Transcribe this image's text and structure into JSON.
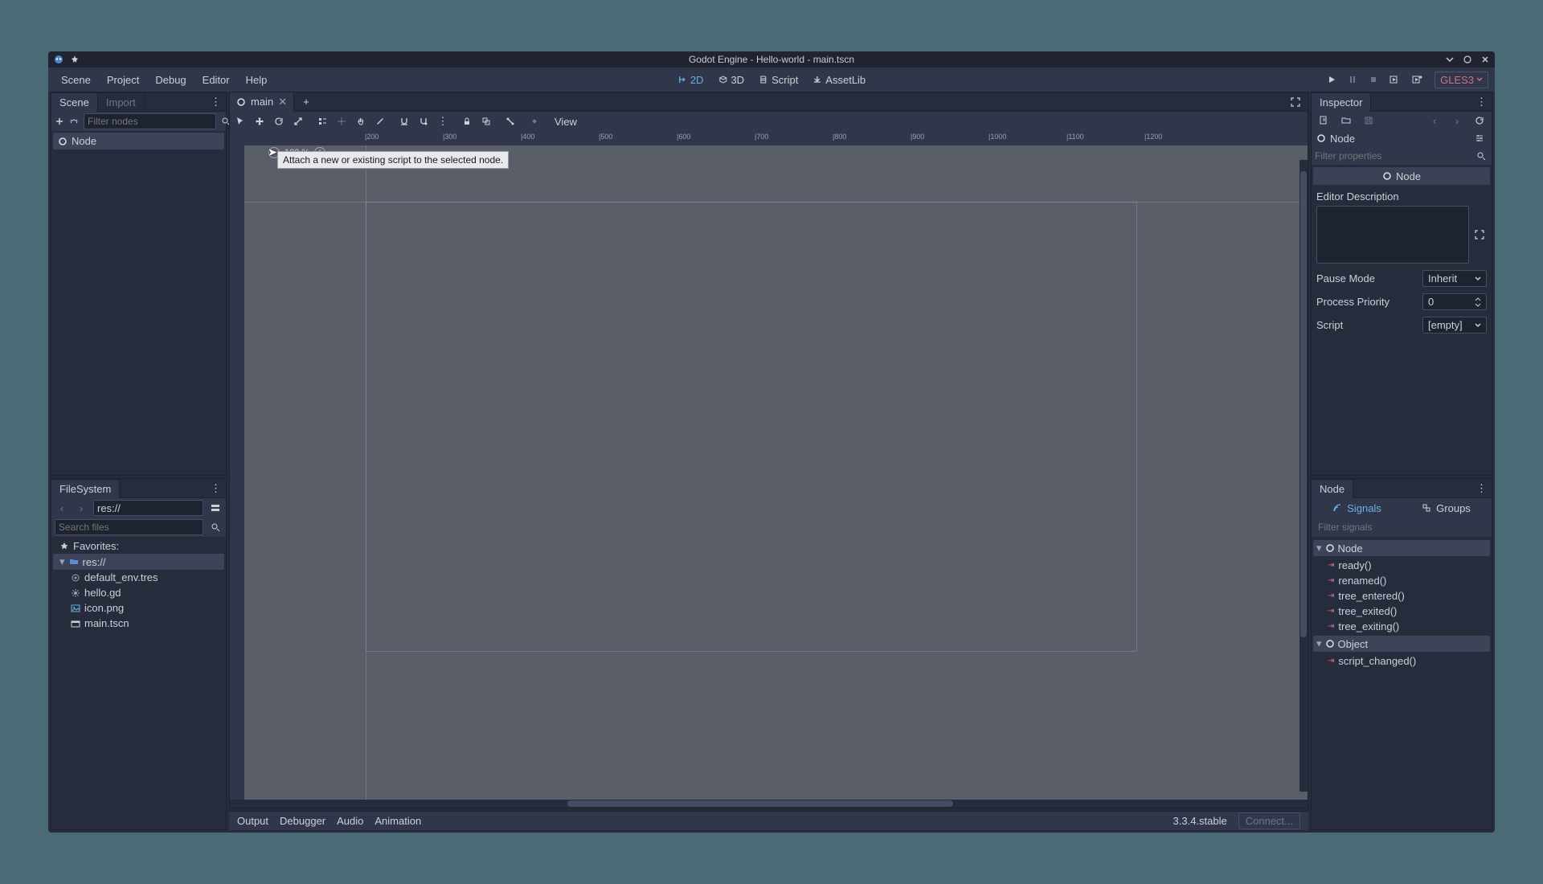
{
  "titlebar": {
    "title": "Godot Engine - Hello-world - main.tscn"
  },
  "menubar": {
    "items": [
      "Scene",
      "Project",
      "Debug",
      "Editor",
      "Help"
    ],
    "modes": {
      "d2": "2D",
      "d3": "3D",
      "script": "Script",
      "assetlib": "AssetLib"
    },
    "renderer": "GLES3"
  },
  "scene_dock": {
    "tabs": {
      "scene": "Scene",
      "import": "Import"
    },
    "filter_placeholder": "Filter nodes",
    "root_node": "Node"
  },
  "tooltip": {
    "text": "Attach a new or existing script to the selected node."
  },
  "filesystem": {
    "title": "FileSystem",
    "path": "res://",
    "search_placeholder": "Search files",
    "favorites": "Favorites:",
    "root": "res://",
    "files": [
      "default_env.tres",
      "hello.gd",
      "icon.png",
      "main.tscn"
    ]
  },
  "scene_tabs": {
    "main": "main"
  },
  "viewport": {
    "view_btn": "View",
    "zoom": "100 %",
    "ruler_h": [
      "|200",
      "|300",
      "|400",
      "|500",
      "|600",
      "|700",
      "|800",
      "|900",
      "|1000",
      "|1100",
      "|1200"
    ],
    "ruler_h_start": 150,
    "ruler_h_step": 97
  },
  "bottom": {
    "tabs": [
      "Output",
      "Debugger",
      "Audio",
      "Animation"
    ],
    "version": "3.3.4.stable",
    "connect": "Connect..."
  },
  "inspector": {
    "title": "Inspector",
    "node_label": "Node",
    "filter_placeholder": "Filter properties",
    "category": "Node",
    "section": "Editor Description",
    "pause_mode": {
      "label": "Pause Mode",
      "value": "Inherit"
    },
    "process_priority": {
      "label": "Process Priority",
      "value": "0"
    },
    "script": {
      "label": "Script",
      "value": "[empty]"
    }
  },
  "node_dock": {
    "title": "Node",
    "signals_tab": "Signals",
    "groups_tab": "Groups",
    "filter_placeholder": "Filter signals",
    "groups": [
      {
        "name": "Node",
        "items": [
          "ready()",
          "renamed()",
          "tree_entered()",
          "tree_exited()",
          "tree_exiting()"
        ]
      },
      {
        "name": "Object",
        "items": [
          "script_changed()"
        ]
      }
    ]
  }
}
